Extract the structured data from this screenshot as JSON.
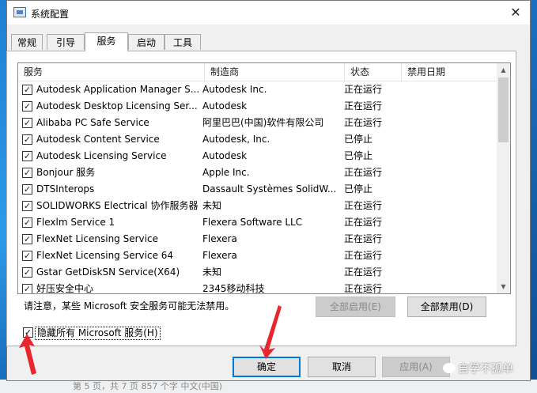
{
  "window": {
    "title": "系统配置",
    "close_glyph": "✕"
  },
  "tabs": [
    {
      "label": "常规"
    },
    {
      "label": "引导"
    },
    {
      "label": "服务"
    },
    {
      "label": "启动"
    },
    {
      "label": "工具"
    }
  ],
  "active_tab": "服务",
  "columns": {
    "service": "服务",
    "manufacturer": "制造商",
    "status": "状态",
    "disabled_date": "禁用日期"
  },
  "services": [
    {
      "name": "Autodesk Application Manager S...",
      "manufacturer": "Autodesk Inc.",
      "status": "正在运行",
      "checked": true
    },
    {
      "name": "Autodesk Desktop Licensing Ser...",
      "manufacturer": "Autodesk",
      "status": "正在运行",
      "checked": true
    },
    {
      "name": "Alibaba PC Safe Service",
      "manufacturer": "阿里巴巴(中国)软件有限公司",
      "status": "正在运行",
      "checked": true
    },
    {
      "name": "Autodesk Content Service",
      "manufacturer": "Autodesk, Inc.",
      "status": "已停止",
      "checked": true
    },
    {
      "name": "Autodesk Licensing Service",
      "manufacturer": "Autodesk",
      "status": "已停止",
      "checked": true
    },
    {
      "name": "Bonjour 服务",
      "manufacturer": "Apple Inc.",
      "status": "正在运行",
      "checked": true
    },
    {
      "name": "DTSInterops",
      "manufacturer": "Dassault Systèmes SolidW...",
      "status": "已停止",
      "checked": true
    },
    {
      "name": "SOLIDWORKS Electrical 协作服务器",
      "manufacturer": "未知",
      "status": "正在运行",
      "checked": true
    },
    {
      "name": "Flexlm Service 1",
      "manufacturer": "Flexera Software LLC",
      "status": "正在运行",
      "checked": true
    },
    {
      "name": "FlexNet Licensing Service",
      "manufacturer": "Flexera",
      "status": "正在运行",
      "checked": true
    },
    {
      "name": "FlexNet Licensing Service 64",
      "manufacturer": "Flexera",
      "status": "正在运行",
      "checked": true
    },
    {
      "name": "Gstar GetDiskSN Service(X64)",
      "manufacturer": "未知",
      "status": "正在运行",
      "checked": true
    },
    {
      "name": "好压安全中心",
      "manufacturer": "2345移动科技",
      "status": "正在运行",
      "checked": true
    }
  ],
  "notice": "请注意，某些 Microsoft 安全服务可能无法禁用。",
  "buttons": {
    "enable_all": "全部启用(E)",
    "disable_all": "全部禁用(D)",
    "ok": "确定",
    "cancel": "取消",
    "apply": "应用(A)"
  },
  "hide_ms": {
    "label": "隐藏所有 Microsoft 服务(H)",
    "checked": true
  },
  "watermark": "自学不孤单",
  "background_strip": "第 5 页，共 7 页   857 个字   中文(中国)",
  "colors": {
    "accent": "#0078d7",
    "arrow": "#e8262d"
  }
}
